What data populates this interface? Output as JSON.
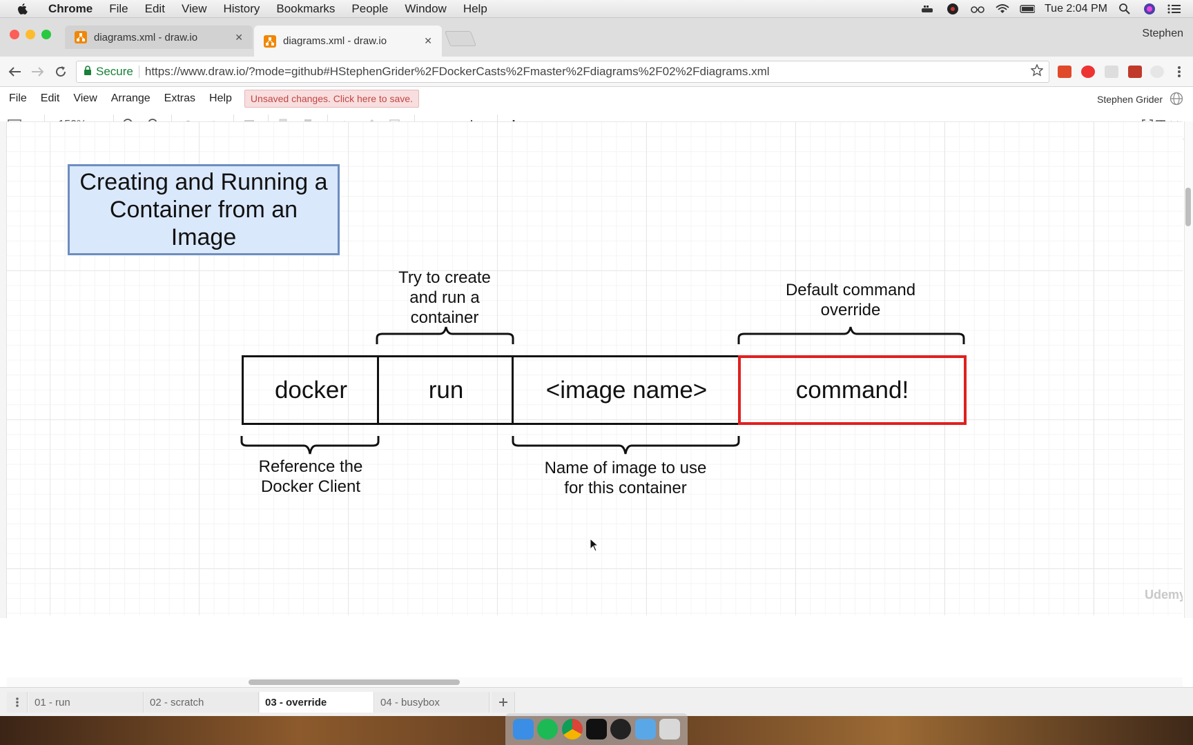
{
  "mac_menubar": {
    "app": "Chrome",
    "items": [
      "File",
      "Edit",
      "View",
      "History",
      "Bookmarks",
      "People",
      "Window",
      "Help"
    ],
    "time": "Tue 2:04 PM"
  },
  "browser": {
    "tabs": [
      {
        "title": "diagrams.xml - draw.io",
        "active": false
      },
      {
        "title": "diagrams.xml - draw.io",
        "active": true
      }
    ],
    "profile": "Stephen",
    "secure_label": "Secure",
    "url": "https://www.draw.io/?mode=github#HStephenGrider%2FDockerCasts%2Fmaster%2Fdiagrams%2F02%2Fdiagrams.xml"
  },
  "drawio": {
    "menu": [
      "File",
      "Edit",
      "View",
      "Arrange",
      "Extras",
      "Help"
    ],
    "unsaved_notice": "Unsaved changes. Click here to save.",
    "user": "Stephen Grider",
    "zoom": "150%"
  },
  "diagram": {
    "title": "Creating and Running a Container from an Image",
    "cells": [
      "docker",
      "run",
      "<image name>",
      "command!"
    ],
    "notes": {
      "run": "Try to create and run a container",
      "command": "Default command override",
      "docker": "Reference the Docker Client",
      "image": "Name of image to use for this container"
    }
  },
  "pages": [
    {
      "label": "01 - run",
      "active": false
    },
    {
      "label": "02 - scratch",
      "active": false
    },
    {
      "label": "03 - override",
      "active": true
    },
    {
      "label": "04 - busybox",
      "active": false
    }
  ],
  "watermark": "Udemy",
  "colors": {
    "title_fill": "#dae8fc",
    "title_stroke": "#6c8ebf",
    "highlight_stroke": "#e02020",
    "unsaved_bg": "#f8dede",
    "unsaved_text": "#c24444"
  }
}
